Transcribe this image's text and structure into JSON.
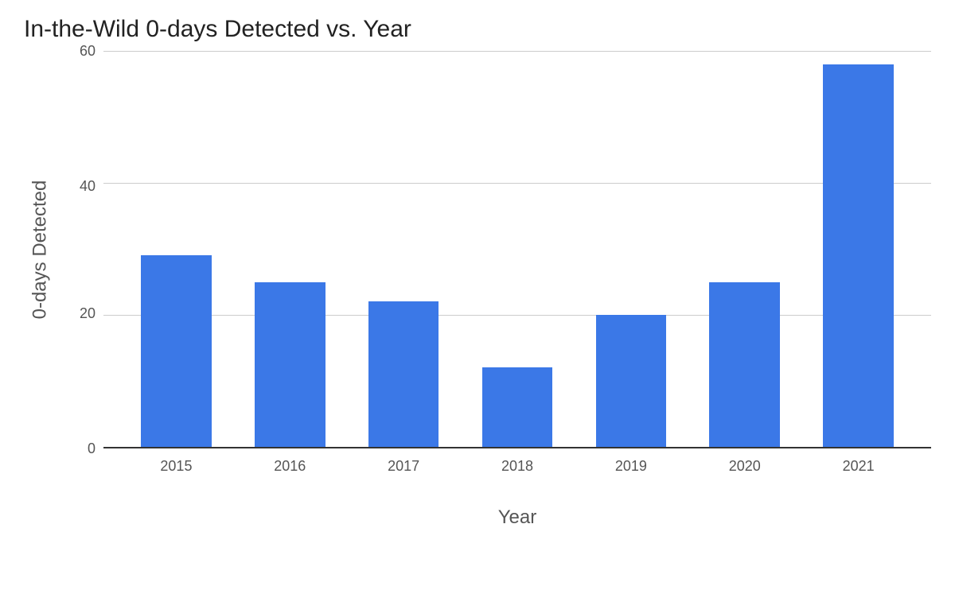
{
  "chart_data": {
    "type": "bar",
    "title": "In-the-Wild 0-days Detected vs. Year",
    "xlabel": "Year",
    "ylabel": "0-days Detected",
    "categories": [
      "2015",
      "2016",
      "2017",
      "2018",
      "2019",
      "2020",
      "2021"
    ],
    "values": [
      29,
      25,
      22,
      12,
      20,
      25,
      58
    ],
    "ylim": [
      0,
      60
    ],
    "y_ticks": [
      60,
      40,
      20,
      0
    ],
    "bar_color": "#3b78e7",
    "gridline_color": "#cccccc"
  }
}
